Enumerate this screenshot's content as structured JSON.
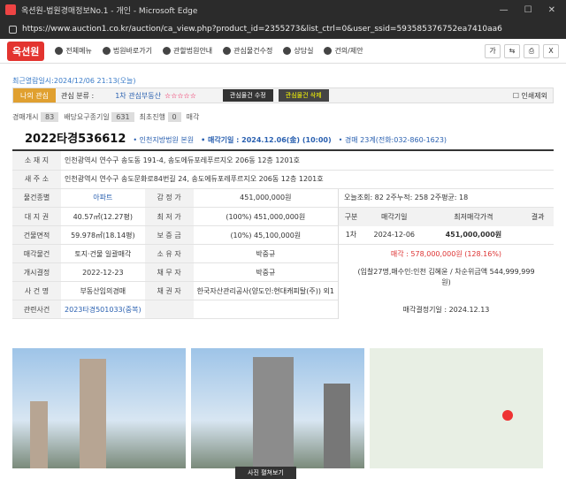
{
  "window": {
    "title": "옥션원-법원경매정보No.1 - 개인 - Microsoft Edge",
    "url": "https://www.auction1.co.kr/auction/ca_view.php?product_id=2355273&list_ctrl=0&user_ssid=593585376752ea7410aa6"
  },
  "header": {
    "logo": "옥션원",
    "menu": [
      "전체메뉴",
      "법원바로가기",
      "관할법원안내",
      "관심물건수정",
      "상담실",
      "건의/제안"
    ],
    "icons": [
      "가",
      "share",
      "print",
      "X"
    ]
  },
  "last_view": "최근열람일시:2024/12/06 21:13(오늘)",
  "favorite": {
    "label": "나의 관심",
    "cat_label": "관심 분류 :",
    "cat": "1차 관심부동산",
    "stars": "☆☆☆☆☆",
    "edit": "관심물건 수정",
    "delete": "관심물건 삭제",
    "print_opt": "인쇄제외"
  },
  "tabs": [
    {
      "label": "경매개시",
      "count": "83"
    },
    {
      "label": "배당요구종기일",
      "count": "631"
    },
    {
      "label": "최초진행",
      "count": "0"
    },
    {
      "label": "매각",
      "count": ""
    }
  ],
  "case": {
    "no": "2022타경536612",
    "court": "• 인천지방법원 본원",
    "date": "• 매각기일 : 2024.12.06(金) (10:00)",
    "dept": "• 경매 23계(전화:032-860-1623)"
  },
  "rows": [
    {
      "h": "소 재 지",
      "v": "인천광역시 연수구 송도동 191-4, 송도에듀포레푸르지오 206동 12층 1201호"
    },
    {
      "h": "새 주 소",
      "v": "인천광역시 연수구 송도문화로84번길 24, 송도에듀포레푸르지오 206동 12층 1201호"
    }
  ],
  "grid": [
    [
      "물건종별",
      "아파트",
      "감 정 가",
      "451,000,000원"
    ],
    [
      "대 지 권",
      "40.57㎡(12.27평)",
      "최 저 가",
      "(100%) 451,000,000원"
    ],
    [
      "건물면적",
      "59.978㎡(18.14평)",
      "보 증 금",
      "(10%) 45,100,000원"
    ],
    [
      "매각물건",
      "토지·건물 일괄매각",
      "소 유 자",
      "박중규"
    ],
    [
      "개시결정",
      "2022-12-23",
      "채 무 자",
      "박중규"
    ],
    [
      "사 건 명",
      "부동산임의경매",
      "채 권 자",
      "한국자산관리공사(양도인:현대캐피탈(주)) 외1"
    ],
    [
      "관련사건",
      "2023타경501033(중복)",
      "",
      ""
    ]
  ],
  "side": {
    "stats": "오늘조회: 82 2주누적: 258 2주평균: 18",
    "hdr": [
      "구분",
      "매각기일",
      "최저매각가격",
      "결과"
    ],
    "row": [
      "1차",
      "2024-12-06",
      "451,000,000원",
      ""
    ],
    "sale": "매각 : 578,000,000원 (128.16%)",
    "bid": "(입찰27명,매수인:인천 김혜윤 / 차순위금액 544,999,999원)",
    "decision": "매각결정기일 : 2024.12.13"
  },
  "photos_more": "사진 펼쳐보기"
}
